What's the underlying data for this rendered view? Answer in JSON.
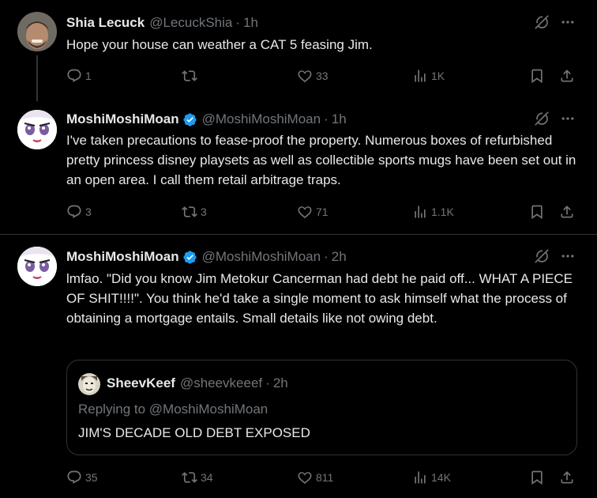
{
  "colors": {
    "background": "#000000",
    "text": "#e7e9ea",
    "muted": "#71767b",
    "verified": "#1d9bf0",
    "divider": "#2f3336"
  },
  "tweets": [
    {
      "name": "Shia Lecuck",
      "handle": "@LecuckShia",
      "dot": "·",
      "time": "1h",
      "verified": false,
      "text": "Hope your house can weather a CAT 5 feasing Jim.",
      "replies": "1",
      "reposts": "",
      "likes": "33",
      "views": "1K"
    },
    {
      "name": "MoshiMoshiMoan",
      "handle": "@MoshiMoshiMoan",
      "dot": "·",
      "time": "1h",
      "verified": true,
      "text": "I've taken precautions to fease-proof the property.  Numerous boxes of refurbished pretty princess disney playsets as well as collectible sports mugs have been set out in an open area.  I call them retail arbitrage traps.",
      "replies": "3",
      "reposts": "3",
      "likes": "71",
      "views": "1.1K"
    },
    {
      "name": "MoshiMoshiMoan",
      "handle": "@MoshiMoshiMoan",
      "dot": "·",
      "time": "2h",
      "verified": true,
      "text": "lmfao.  \"Did you know Jim Metokur Cancerman had debt he paid off... WHAT A PIECE OF SHIT!!!!\".  You think he'd take a single moment to ask himself what the process of obtaining a mortgage entails.  Small details like not owing debt.",
      "quote": {
        "name": "SheevKeef",
        "handle": "@sheevkeeef",
        "dot": "·",
        "time": "2h",
        "replying_to": "Replying to @MoshiMoshiMoan",
        "text": "JIM'S DECADE OLD DEBT EXPOSED"
      },
      "replies": "35",
      "reposts": "34",
      "likes": "811",
      "views": "14K"
    }
  ],
  "icons": [
    "grok-icon",
    "more-icon",
    "reply-icon",
    "repost-icon",
    "like-icon",
    "views-icon",
    "bookmark-icon",
    "share-icon",
    "verified-icon"
  ]
}
